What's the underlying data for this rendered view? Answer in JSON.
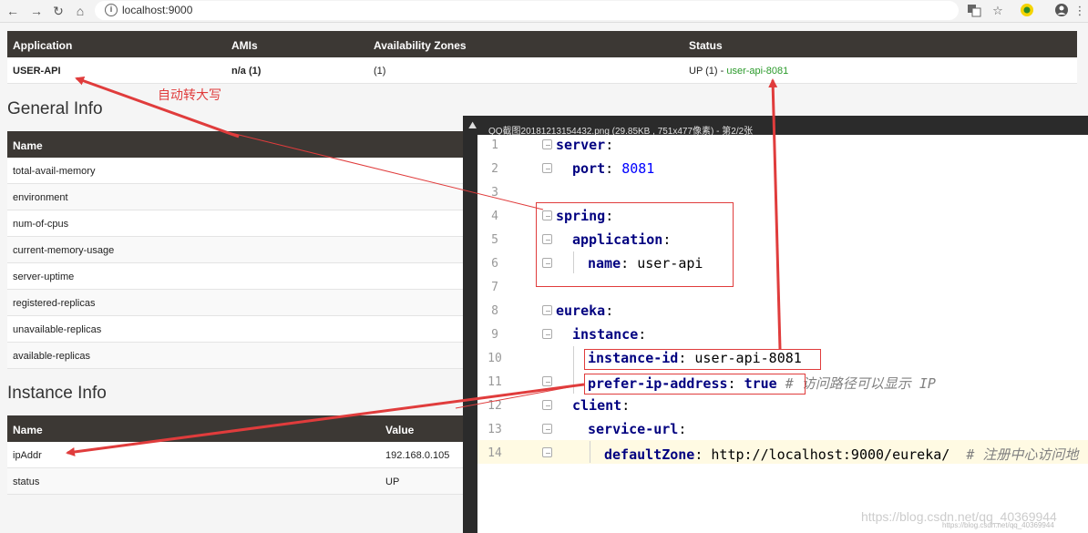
{
  "browser": {
    "back_icon": "←",
    "forward_icon": "→",
    "reload_icon": "↻",
    "home_icon": "⌂",
    "url": "localhost:9000"
  },
  "applications": {
    "headers": [
      "Application",
      "AMIs",
      "Availability Zones",
      "Status"
    ],
    "row": {
      "application": "USER-API",
      "amis": "n/a (1)",
      "zones": "(1)",
      "status_prefix": "UP (1) - ",
      "status_link": "user-api-8081"
    }
  },
  "general_info": {
    "title": "General Info",
    "header_name": "Name",
    "rows": [
      "total-avail-memory",
      "environment",
      "num-of-cpus",
      "current-memory-usage",
      "server-uptime",
      "registered-replicas",
      "unavailable-replicas",
      "available-replicas"
    ]
  },
  "instance_info": {
    "title": "Instance Info",
    "header_name": "Name",
    "header_value": "Value",
    "rows": [
      {
        "name": "ipAddr",
        "value": "192.168.0.105"
      },
      {
        "name": "status",
        "value": "UP"
      }
    ]
  },
  "viewer": {
    "title": "QQ截图20181213154432.png (29.85KB , 751x477像素) - 第2/2张",
    "lines": [
      {
        "no": "1"
      },
      {
        "no": "2"
      },
      {
        "no": "3"
      },
      {
        "no": "4"
      },
      {
        "no": "5"
      },
      {
        "no": "6"
      },
      {
        "no": "7"
      },
      {
        "no": "8"
      },
      {
        "no": "9"
      },
      {
        "no": "10"
      },
      {
        "no": "11"
      },
      {
        "no": "12"
      },
      {
        "no": "13"
      },
      {
        "no": "14"
      }
    ],
    "code": {
      "l1_key": "server",
      "l2_key": "port",
      "l2_val": "8081",
      "l4_key": "spring",
      "l5_key": "application",
      "l6_key": "name",
      "l6_val": "user-api",
      "l8_key": "eureka",
      "l9_key": "instance",
      "l10_key": "instance-id",
      "l10_val": "user-api-8081",
      "l11_key": "prefer-ip-address",
      "l11_val": "true",
      "l11_comment": "# 访问路径可以显示 IP",
      "l12_key": "client",
      "l13_key": "service-url",
      "l14_key": "defaultZone",
      "l14_val": "http://localhost:9000/eureka/",
      "l14_comment": "# 注册中心访问地"
    }
  },
  "annotations": {
    "auto_upper": "自动转大写",
    "watermark": "https://blog.csdn.net/qq_40369944",
    "watermark_small": "https://blog.csdn.net/qq_40369944"
  }
}
